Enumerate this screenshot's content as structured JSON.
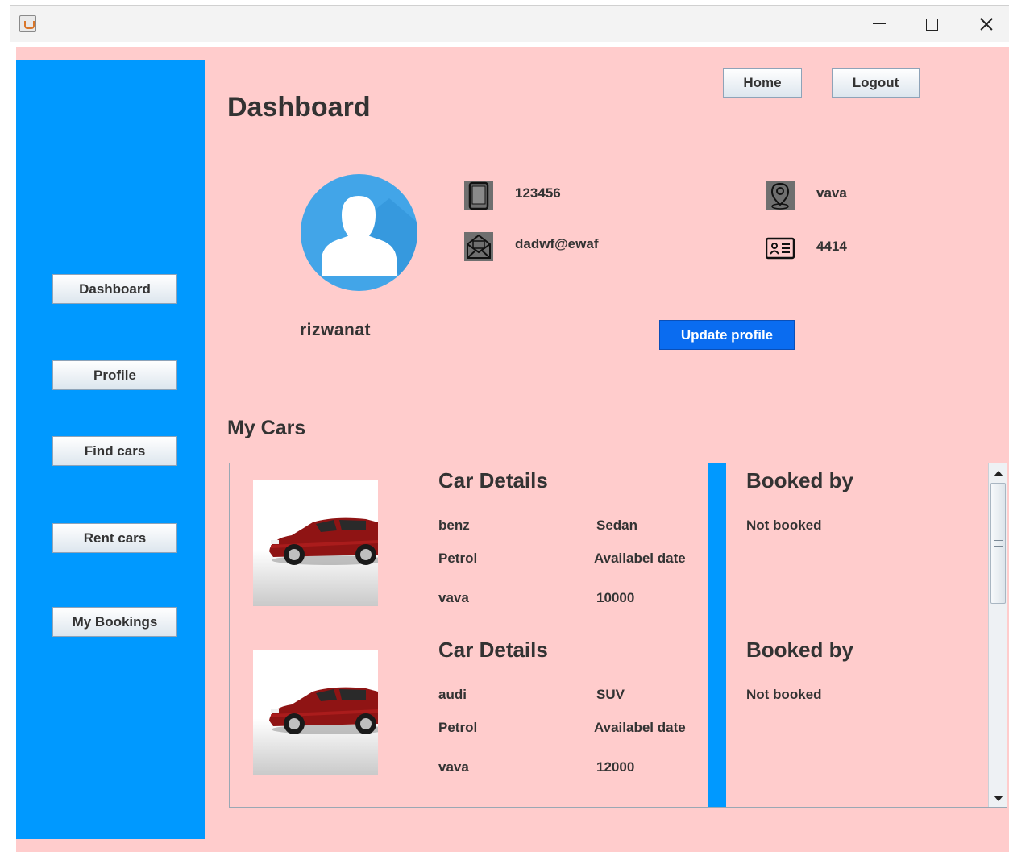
{
  "window": {
    "icon": "java-coffee-icon",
    "controls": [
      "minimize-icon",
      "maximize-icon",
      "close-icon"
    ]
  },
  "sidebar": {
    "items": [
      {
        "label": "Dashboard"
      },
      {
        "label": "Profile"
      },
      {
        "label": "Find cars"
      },
      {
        "label": "Rent cars"
      },
      {
        "label": "My Bookings"
      }
    ]
  },
  "header": {
    "title": "Dashboard",
    "home_label": "Home",
    "logout_label": "Logout"
  },
  "profile": {
    "username": "rizwanat",
    "phone": "123456",
    "email": "dadwf@ewaf",
    "location": "vava",
    "id_number": "4414",
    "update_label": "Update profile"
  },
  "my_cars": {
    "title": "My Cars",
    "cars": [
      {
        "heading": "Car Details",
        "name": "benz",
        "type": "Sedan",
        "fuel": "Petrol",
        "date_label": "Availabel date",
        "location": "vava",
        "price": "10000",
        "booked_heading": "Booked by",
        "booked_status": "Not booked"
      },
      {
        "heading": "Car Details",
        "name": "audi",
        "type": "SUV",
        "fuel": "Petrol",
        "date_label": "Availabel date",
        "location": "vava",
        "price": "12000",
        "booked_heading": "Booked by",
        "booked_status": "Not booked"
      }
    ]
  },
  "colors": {
    "sidebar": "#0099ff",
    "background": "#ffcccc",
    "primary_button": "#0a6cf0"
  }
}
